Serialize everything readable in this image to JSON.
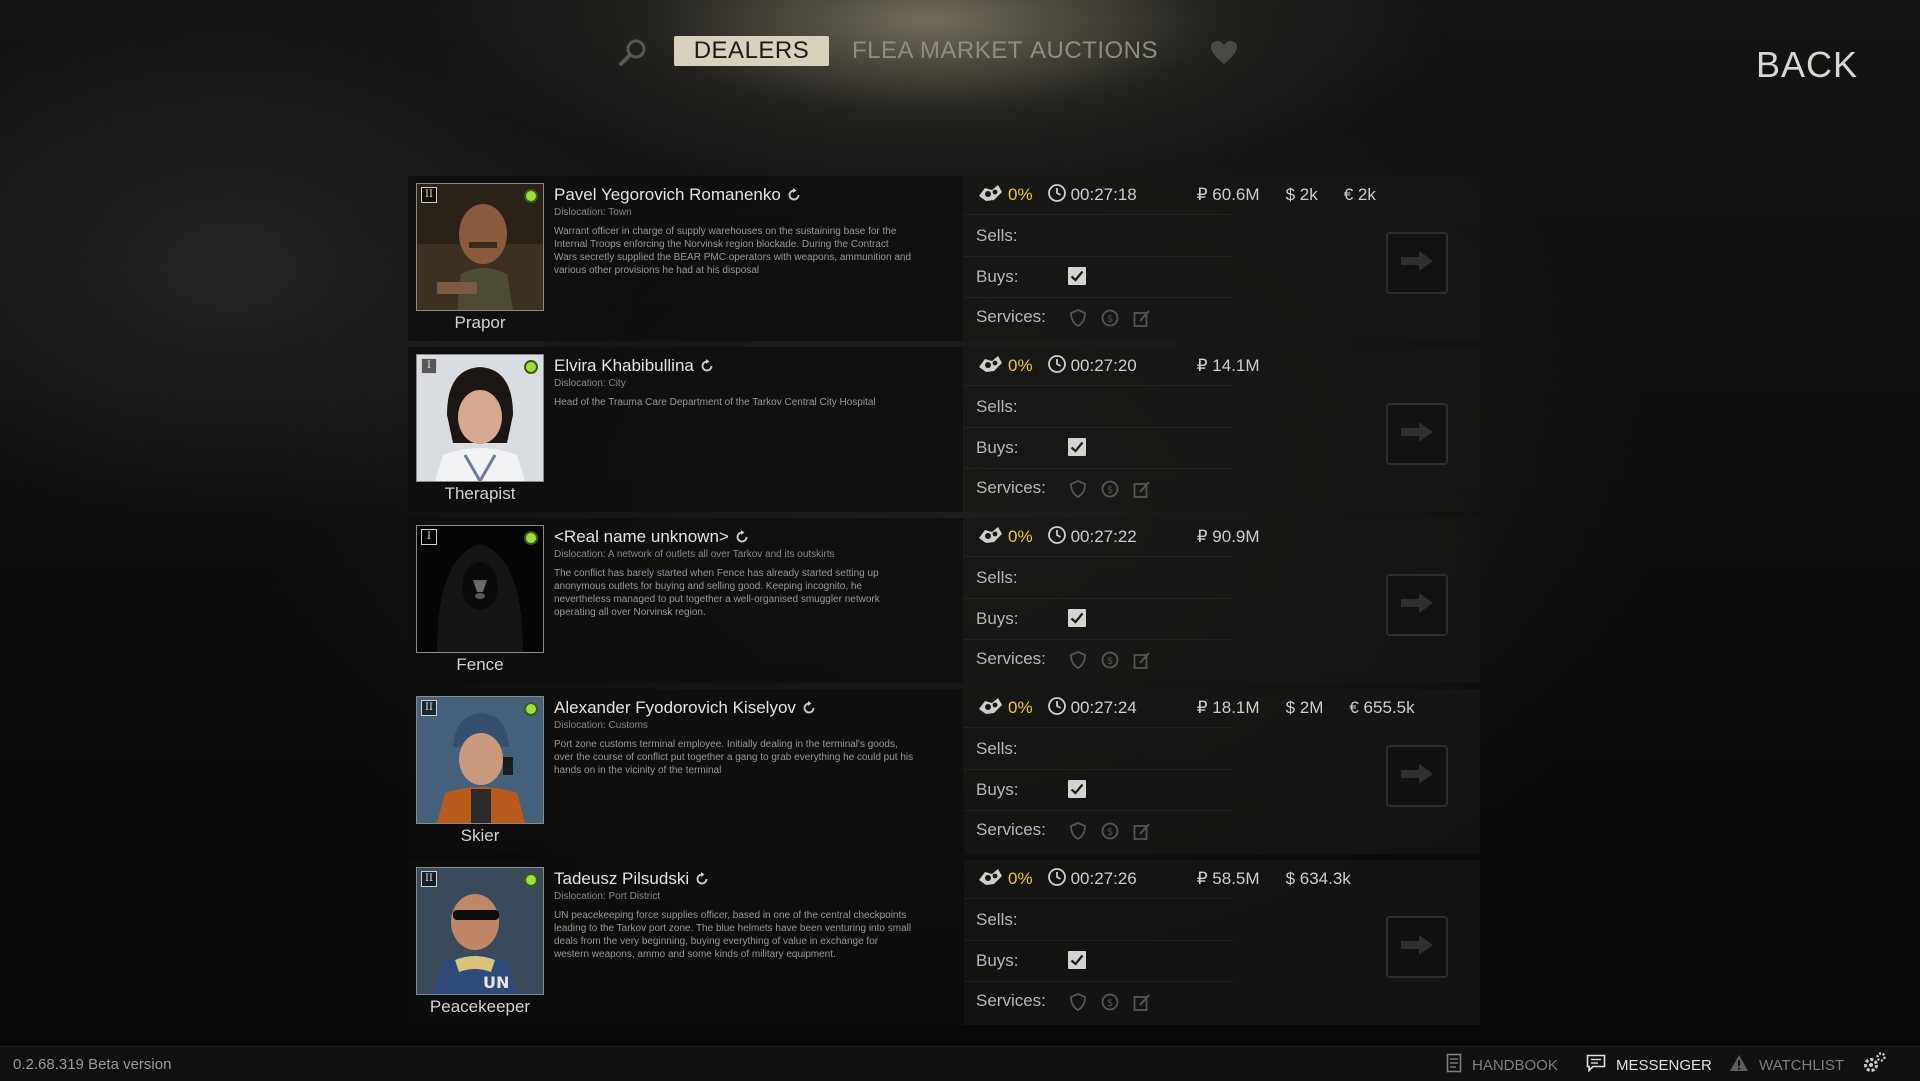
{
  "nav": {
    "tabs": [
      {
        "label": "DEALERS",
        "active": true
      },
      {
        "label": "FLEA MARKET",
        "active": false
      },
      {
        "label": "AUCTIONS",
        "active": false
      }
    ],
    "back_label": "BACK",
    "search_icon": "search-icon",
    "wishlist_icon": "heart-icon"
  },
  "labels": {
    "sells": "Sells:",
    "buys": "Buys:",
    "services": "Services:"
  },
  "colors": {
    "standing": "#f1cc22",
    "online": "#9be03c",
    "active_tab": "#d8d1bd"
  },
  "traders": [
    {
      "nickname": "Prapor",
      "name": "Pavel Yegorovich Romanenko",
      "level": "II",
      "dislocation": "Dislocation: Town",
      "description": "Warrant officer in charge of supply warehouses on the sustaining base for the Internal Troops enforcing the Norvinsk region blockade. During the Contract Wars secretly supplied the BEAR PMC operators with weapons, ammunition and various other provisions he had at his disposal",
      "standing": "0%",
      "timer": "00:27:18",
      "rub": "₽ 60.6M",
      "usd": "$ 2k",
      "eur": "€ 2k",
      "buys_checked": true
    },
    {
      "nickname": "Therapist",
      "name": "Elvira Khabibullina",
      "level": "I",
      "dislocation": "Dislocation: City",
      "description": "Head of the Trauma Care Department of the Tarkov Central City Hospital",
      "standing": "0%",
      "timer": "00:27:20",
      "rub": "₽ 14.1M",
      "usd": "",
      "eur": "",
      "buys_checked": true
    },
    {
      "nickname": "Fence",
      "name": "<Real name unknown>",
      "level": "I",
      "dislocation": "Dislocation: A network of outlets all over Tarkov and its outskirts",
      "description": "The conflict has barely started when Fence has already started setting up anonymous outlets for buying and selling good. Keeping incognito, he nevertheless managed to put together a well-organised smuggler network operating all over Norvinsk region.",
      "standing": "0%",
      "timer": "00:27:22",
      "rub": "₽ 90.9M",
      "usd": "",
      "eur": "",
      "buys_checked": true
    },
    {
      "nickname": "Skier",
      "name": "Alexander Fyodorovich Kiselyov",
      "level": "II",
      "dislocation": "Dislocation: Customs",
      "description": "Port zone customs terminal employee. Initially dealing in the terminal's goods, over the course of conflict put together a gang to grab everything he could put his hands on in the vicinity of the terminal",
      "standing": "0%",
      "timer": "00:27:24",
      "rub": "₽ 18.1M",
      "usd": "$ 2M",
      "eur": "€ 655.5k",
      "buys_checked": true
    },
    {
      "nickname": "Peacekeeper",
      "name": "Tadeusz Pilsudski",
      "level": "II",
      "dislocation": "Dislocation: Port District",
      "description": "UN peacekeeping force supplies officer, based in one of the central checkpoints leading to the Tarkov port zone. The blue helmets have been venturing into small deals from the very beginning, buying everything of value in exchange for western weapons, ammo and some kinds of military equipment.",
      "standing": "0%",
      "timer": "00:27:26",
      "rub": "₽ 58.5M",
      "usd": "$ 634.3k",
      "eur": "",
      "buys_checked": true
    }
  ],
  "bottom": {
    "version": "0.2.68.319 Beta version",
    "handbook": "HANDBOOK",
    "messenger": "MESSENGER",
    "watchlist": "WATCHLIST"
  }
}
